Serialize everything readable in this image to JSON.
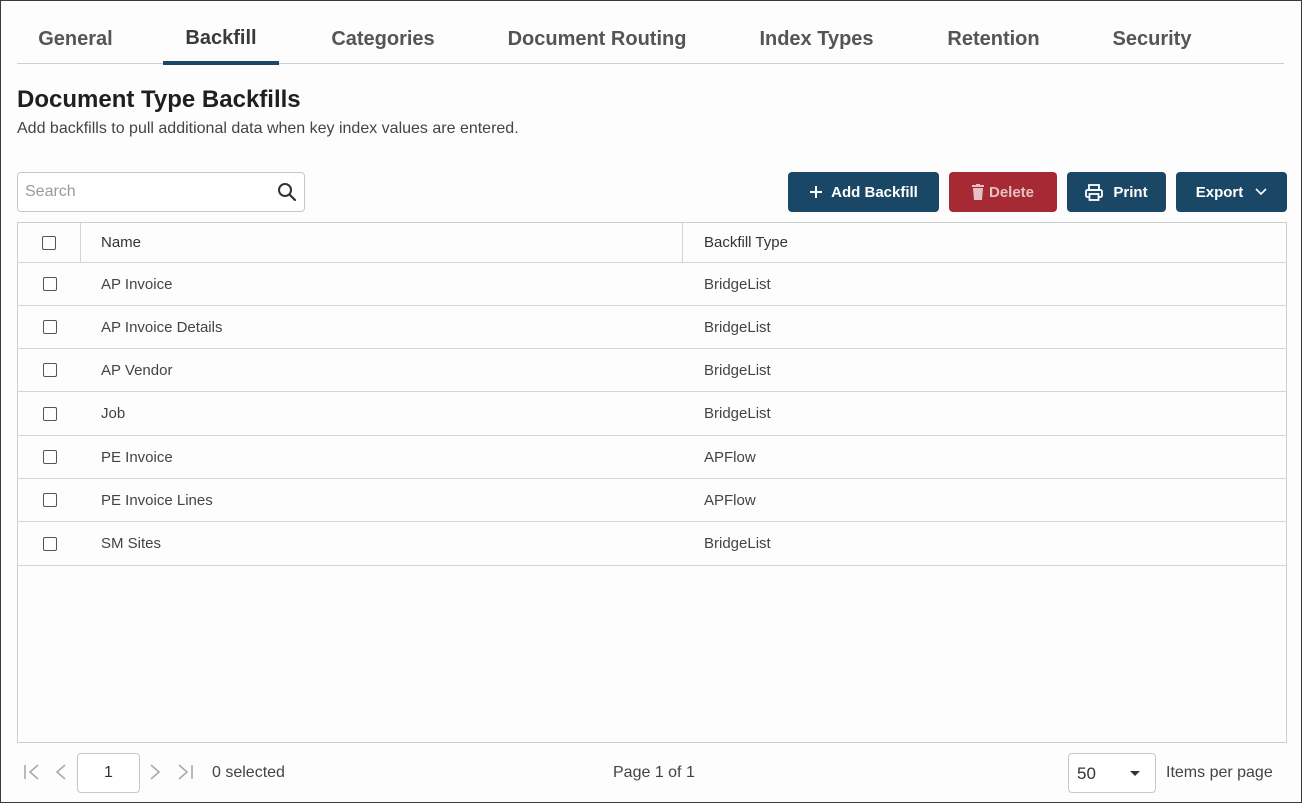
{
  "tabs": [
    {
      "label": "General",
      "active": false
    },
    {
      "label": "Backfill",
      "active": true
    },
    {
      "label": "Categories",
      "active": false
    },
    {
      "label": "Document Routing",
      "active": false
    },
    {
      "label": "Index Types",
      "active": false
    },
    {
      "label": "Retention",
      "active": false
    },
    {
      "label": "Security",
      "active": false
    }
  ],
  "header": {
    "title": "Document Type Backfills",
    "subtitle": "Add backfills to pull additional data when key index values are entered."
  },
  "search": {
    "placeholder": "Search",
    "value": "",
    "icon": "search-icon"
  },
  "toolbar": {
    "add_label": "Add Backfill",
    "delete_label": "Delete",
    "print_label": "Print",
    "export_label": "Export"
  },
  "table": {
    "columns": [
      "Name",
      "Backfill Type"
    ],
    "rows": [
      {
        "name": "AP Invoice",
        "type": "BridgeList"
      },
      {
        "name": "AP Invoice Details",
        "type": "BridgeList"
      },
      {
        "name": "AP Vendor",
        "type": "BridgeList"
      },
      {
        "name": "Job",
        "type": "BridgeList"
      },
      {
        "name": "PE Invoice",
        "type": "APFlow"
      },
      {
        "name": "PE Invoice Lines",
        "type": "APFlow"
      },
      {
        "name": "SM Sites",
        "type": "BridgeList"
      }
    ]
  },
  "footer": {
    "page_value": "1",
    "selected_text": "0 selected",
    "page_text": "Page 1 of 1",
    "page_size": "50",
    "items_label": "Items per page"
  },
  "colors": {
    "primary": "#1b4766",
    "danger": "#a52a33"
  }
}
